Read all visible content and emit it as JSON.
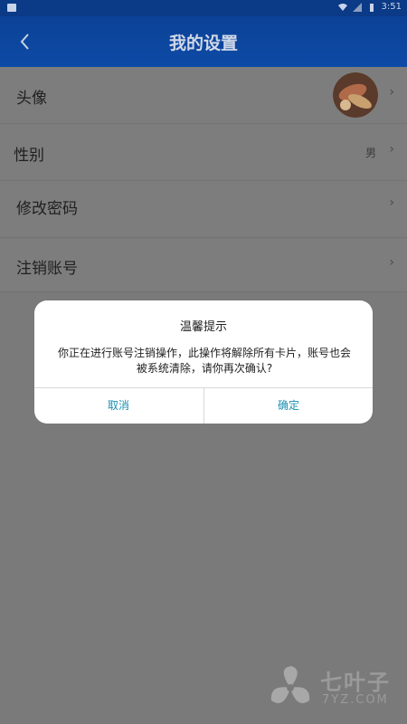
{
  "status_bar": {
    "time": "3:51"
  },
  "header": {
    "title": "我的设置",
    "back_icon": "back-arrow-icon"
  },
  "settings": {
    "items": [
      {
        "label": "头像",
        "value": "",
        "chevron": "›"
      },
      {
        "label": "性别",
        "value": "男",
        "chevron": "›"
      },
      {
        "label": "修改密码",
        "value": "",
        "chevron": "›"
      },
      {
        "label": "注销账号",
        "value": "",
        "chevron": "›"
      }
    ]
  },
  "dialog": {
    "title": "温馨提示",
    "message": "你正在进行账号注销操作，此操作将解除所有卡片，账号也会被系统清除，请你再次确认?",
    "cancel_label": "取消",
    "confirm_label": "确定",
    "button_color": "#1a90b0"
  },
  "watermark": {
    "name": "七叶子",
    "url": "7YZ.COM"
  },
  "colors": {
    "header": "#0c4296",
    "overlay": "#7a7a7a"
  }
}
